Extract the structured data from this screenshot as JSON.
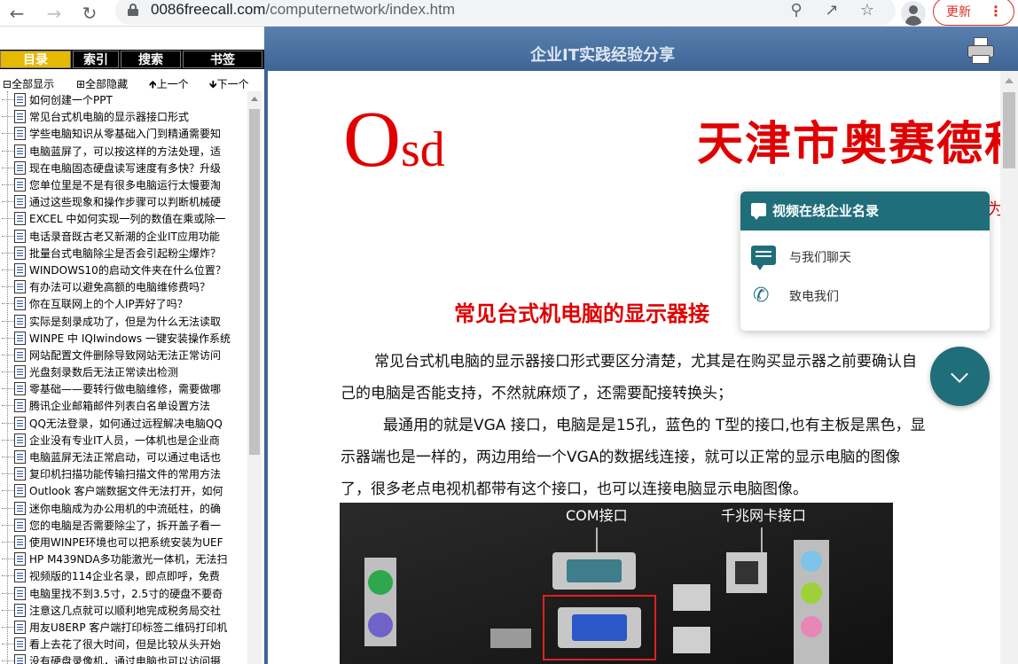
{
  "browser": {
    "url_host": "0086freecall.com",
    "url_path": "/computernetwork/index.htm",
    "update_label": "更新"
  },
  "left": {
    "tabs": [
      {
        "label": "目录",
        "active": true
      },
      {
        "label": "索引",
        "active": false
      },
      {
        "label": "搜索",
        "active": false
      },
      {
        "label": "书签",
        "active": false
      }
    ],
    "controls": {
      "show_all": "全部显示",
      "hide_all": "全部隐藏",
      "up": "上一个",
      "down": "下一个"
    },
    "items": [
      "如何创建一个PPT",
      "常见台式机电脑的显示器接口形式",
      "学些电脑知识从零基础入门到精通需要知",
      "电脑蓝屏了，可以按这样的方法处理，适",
      "现在电脑固态硬盘读写速度有多快？升级",
      "您单位里是不是有很多电脑运行太慢要淘",
      "通过这些现象和操作步骤可以判断机械硬",
      "EXCEL 中如何实现一列的数值在乘或除一",
      "电话录音既古老又新潮的企业IT应用功能",
      "批量台式电脑除尘是否会引起粉尘爆炸？",
      "WINDOWS10的启动文件夹在什么位置？",
      "有办法可以避免高额的电脑维修费吗？",
      "你在互联网上的个人IP弄好了吗？",
      "实际是刻录成功了，但是为什么无法读取",
      "WINPE 中 IQIwindows 一键安装操作系统",
      "网站配置文件删除导致网站无法正常访问",
      "光盘刻录数后无法正常读出检测",
      "零基础——要转行做电脑维修，需要做哪",
      "腾讯企业邮箱邮件列表白名单设置方法",
      "QQ无法登录，如何通过远程解决电脑QQ",
      "企业没有专业IT人员，一体机也是企业商",
      "电脑蓝屏无法正常启动，可以通过电话也",
      "复印机扫描功能传输扫描文件的常用方法",
      "Outlook 客户端数据文件无法打开，如何",
      "迷你电脑成为办公用机的中流砥柱，的确",
      "您的电脑是否需要除尘了，拆开盖子看一",
      "使用WINPE环境也可以把系统安装为UEF",
      "HP M439NDA多功能激光一体机，无法扫",
      "视频版的114企业名录，即点即呼，免费",
      "电脑里找不到3.5寸，2.5寸的硬盘不要奇",
      "注意这几点就可以顺利地完成税务局交社",
      "用友U8ERP 客户端打印标签二维码打印机",
      "看上去花了很大时间，但是比较从头开始",
      "没有硬盘录像机，通过电脑也可以访问摄"
    ]
  },
  "banner": {
    "title": "企业IT实践经验分享"
  },
  "content": {
    "logo_big": "O",
    "logo_small": "sd",
    "company": "天津市奥赛德科",
    "company_sub": "为",
    "article_title": "常见台式机电脑的显示器接",
    "paragraphs": [
      "常见台式机电脑的显示器接口形式要区分清楚，尤其是在购买显示器之前要确认自己的电脑是否能支持，不然就麻烦了，还需要配接转换头；",
      "最通用的就是VGA 接口，电脑是是15孔，蓝色的 T型的接口,也有主板是黑色，显示器端也是一样的，两边用给一个VGA的数据线连接，就可以正常的显示电脑的图像了，很多老点电视机都带有这个接口，也可以连接电脑显示电脑图像。"
    ],
    "photo_labels": {
      "com": "COM接口",
      "nic": "千兆网卡接口"
    }
  },
  "chat": {
    "title": "视频在线企业名录",
    "chat_label": "与我们聊天",
    "call_label": "致电我们"
  }
}
